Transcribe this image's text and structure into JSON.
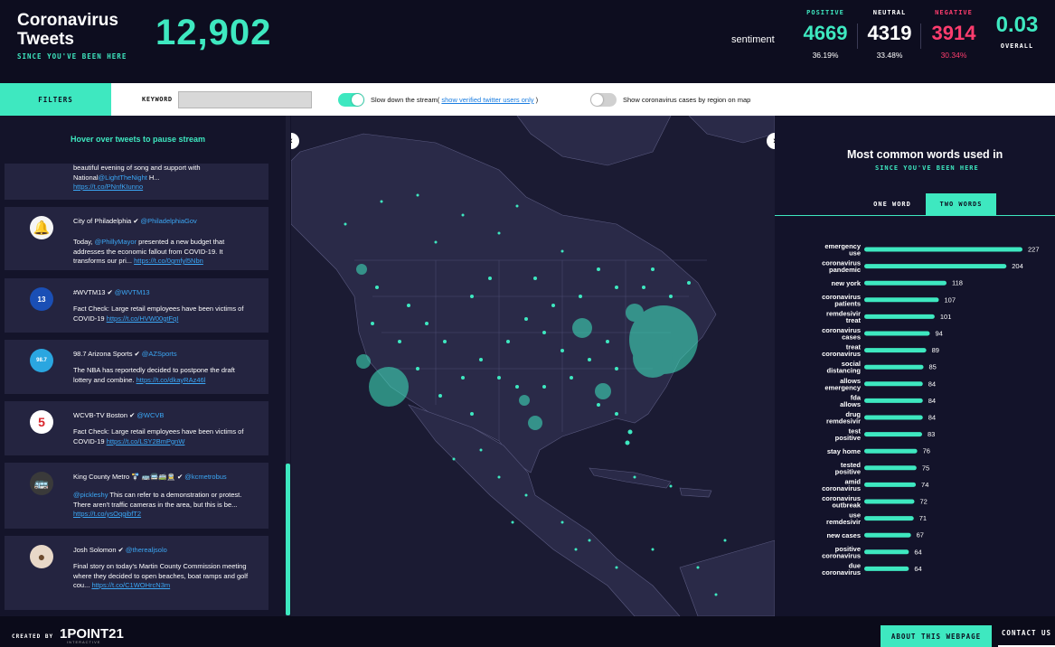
{
  "header": {
    "title": "Coronavirus Tweets",
    "subtitle": "SINCE YOU'VE BEEN HERE",
    "tweet_count": "12,902",
    "sentiment_label": "sentiment",
    "positive": {
      "label": "POSITIVE",
      "value": "4669",
      "pct": "36.19%",
      "color": "#3ee8c0"
    },
    "neutral": {
      "label": "NEUTRAL",
      "value": "4319",
      "pct": "33.48%",
      "color": "#ffffff"
    },
    "negative": {
      "label": "NEGATIVE",
      "value": "3914",
      "pct": "30.34%",
      "color": "#ff3d6e"
    },
    "overall": {
      "label": "OVERALL",
      "value": "0.03",
      "color": "#3ee8c0"
    }
  },
  "filters": {
    "tab_label": "FILTERS",
    "keyword_label": "KEYWORD",
    "keyword_value": "",
    "slow_label": "Slow down the stream(",
    "verified_link": "show verified twitter users only",
    "slow_close": ")",
    "cases_label": "Show coronavirus cases by region on map"
  },
  "left_panel": {
    "hover_hint": "Hover over tweets to pause stream",
    "tweets": [
      {
        "author": "",
        "handle": "",
        "body_pre": "beautiful evening of song and support with National",
        "mention": "@LightTheNight",
        "body_post": " H...",
        "link": "https://t.co/PNnfKIunno",
        "avatar": ""
      },
      {
        "author": "City of Philadelphia",
        "handle": "@PhiladelphiaGov",
        "body_pre": "Today, ",
        "mention": "@PhillyMayor",
        "body_post": " presented a new budget that addresses the economic fallout from COVID-19. It transforms our pri... ",
        "link": "https://t.co/0gmfyl5Nbn",
        "avatar": "bell-icon"
      },
      {
        "author": "#WVTM13",
        "handle": "@WVTM13",
        "body_pre": "Fact Check: Large retail employees have been victims of COVID-19 ",
        "mention": "",
        "body_post": "",
        "link": "https://t.co/HVW00gtFqI",
        "avatar": "13"
      },
      {
        "author": "98.7 Arizona Sports",
        "handle": "@AZSports",
        "body_pre": "The NBA has reportedly decided to postpone the draft lottery and combine. ",
        "mention": "",
        "body_post": "",
        "link": "https://t.co/dkayRAz46l",
        "avatar": "98.7"
      },
      {
        "author": "WCVB-TV Boston",
        "handle": "@WCVB",
        "body_pre": "Fact Check: Large retail employees have been victims of COVID-19 ",
        "mention": "",
        "body_post": "",
        "link": "https://t.co/LSY2BmPgnW",
        "avatar": "5"
      },
      {
        "author": "King County Metro 🚏 🚌🚍🚎🚊",
        "handle": "@kcmetrobus",
        "body_pre": "",
        "mention": "@pickleshy",
        "body_post": " This can refer to a demonstration or protest. There aren't traffic cameras in the area, but this is be... ",
        "link": "https://t.co/ysOqgibfT2",
        "avatar": "bus-icon"
      },
      {
        "author": "Josh Solomon",
        "handle": "@therealjsolo",
        "body_pre": "Final story on today's Martin County Commission meeting where they decided to open beaches, boat ramps and golf cou... ",
        "mention": "",
        "body_post": "",
        "link": "https://t.co/C1WOHrcN3m",
        "avatar": "person-icon"
      }
    ]
  },
  "map": {
    "prev_label": "‹",
    "next_label": "›"
  },
  "right_panel": {
    "title": "Most common words used in",
    "subtitle": "SINCE YOU'VE BEEN HERE",
    "tab_one": "ONE WORD",
    "tab_two": "TWO WORDS"
  },
  "chart_data": {
    "type": "bar",
    "orientation": "horizontal",
    "categories": [
      "emergency use",
      "coronavirus pandemic",
      "new york",
      "coronavirus patients",
      "remdesivir treat",
      "coronavirus cases",
      "treat coronavirus",
      "social distancing",
      "allows emergency",
      "fda allows",
      "drug remdesivir",
      "test positive",
      "stay home",
      "tested positive",
      "amid coronavirus",
      "coronavirus outbreak",
      "use remdesivir",
      "new cases",
      "positive coronavirus",
      "due coronavirus"
    ],
    "values": [
      227,
      204,
      118,
      107,
      101,
      94,
      89,
      85,
      84,
      84,
      84,
      83,
      76,
      75,
      74,
      72,
      71,
      67,
      64,
      64
    ],
    "color": "#3ee8c0"
  },
  "footer": {
    "created_by": "CREATED BY",
    "brand": "1POINT21",
    "brand_sub": "INTERACTIVE",
    "about": "ABOUT THIS WEBPAGE",
    "contact": "CONTACT US"
  }
}
